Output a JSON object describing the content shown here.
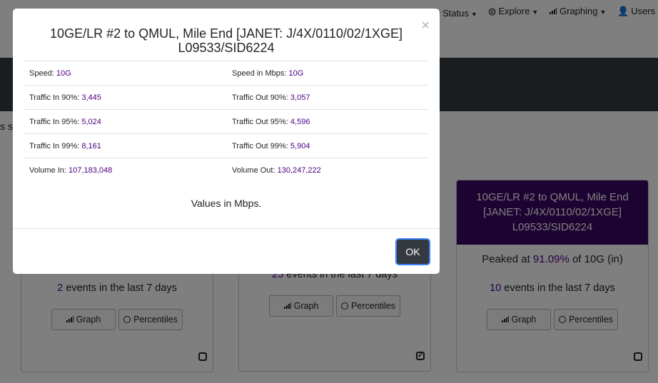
{
  "navbar": {
    "items": [
      {
        "label": "Status",
        "icon": "info-circle-icon"
      },
      {
        "label": "Explore",
        "icon": "globe-icon"
      },
      {
        "label": "Graphing",
        "icon": "bar-chart-icon"
      },
      {
        "label": "Users",
        "icon": "user-icon"
      }
    ]
  },
  "page": {
    "partial_text": "s sh"
  },
  "cards": [
    {
      "events_count": "2",
      "events_suffix": " events in the last 7 days",
      "graph_label": "Graph",
      "percentiles_label": "Percentiles",
      "checked": false
    },
    {
      "events_count": "23",
      "events_suffix": " events in the last 7 days",
      "graph_label": "Graph",
      "percentiles_label": "Percentiles",
      "checked": true
    },
    {
      "title": "10GE/LR #2 to QMUL, Mile End [JANET: J/4X/0110/02/1XGE] L09533/SID6224",
      "peak_prefix": "Peaked at ",
      "peak_value": "91.09%",
      "peak_suffix": " of 10G (in)",
      "events_count": "10",
      "events_suffix": " events in the last 7 days",
      "graph_label": "Graph",
      "percentiles_label": "Percentiles",
      "checked": false
    }
  ],
  "modal": {
    "title": "10GE/LR #2 to QMUL, Mile End [JANET: J/4X/0110/02/1XGE] L09533/SID6224",
    "close_symbol": "×",
    "rows": [
      {
        "left_label": "Speed: ",
        "left_value": "10G",
        "right_label": "Speed in Mbps: ",
        "right_value": "10G"
      },
      {
        "left_label": "Traffic In 90%: ",
        "left_value": "3,445",
        "right_label": "Traffic Out 90%: ",
        "right_value": "3,057"
      },
      {
        "left_label": "Traffic In 95%: ",
        "left_value": "5,024",
        "right_label": "Traffic Out 95%: ",
        "right_value": "4,596"
      },
      {
        "left_label": "Traffic In 99%: ",
        "left_value": "8,161",
        "right_label": "Traffic Out 99%: ",
        "right_value": "5,904"
      },
      {
        "left_label": "Volume In: ",
        "left_value": "107,183,048",
        "right_label": "Volume Out: ",
        "right_value": "130,247,222"
      }
    ],
    "units_note": "Values in Mbps.",
    "ok_label": "OK"
  },
  "colors": {
    "accent_purple": "#3b0764",
    "value_text": "#4b0082",
    "dark_band": "#343a40",
    "ok_button": "#343a40"
  }
}
